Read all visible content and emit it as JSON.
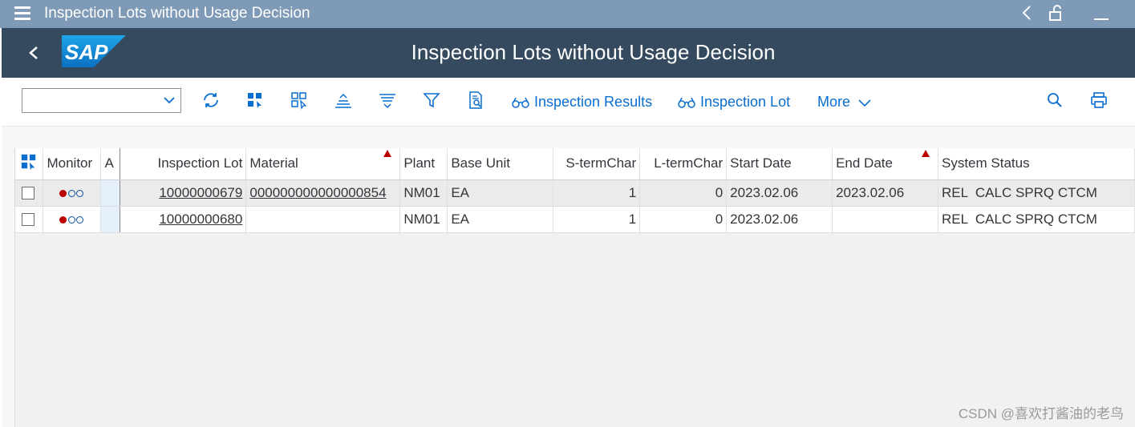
{
  "window": {
    "title": "Inspection Lots without Usage Decision"
  },
  "shell": {
    "app_title": "Inspection Lots without Usage Decision",
    "logo_text": "SAP"
  },
  "toolbar": {
    "variant_select": {
      "value": ""
    },
    "icons": [
      "refresh-icon",
      "select-all-icon",
      "deselect-all-icon",
      "sort-ascending-icon",
      "sort-descending-icon",
      "filter-icon",
      "document-search-icon"
    ],
    "inspection_results_label": "Inspection Results",
    "inspection_lot_label": "Inspection Lot",
    "more_label": "More"
  },
  "table": {
    "columns": [
      "Monitor",
      "A",
      "Inspection Lot",
      "Material",
      "Plant",
      "Base Unit",
      "S-termChar",
      "L-termChar",
      "Start Date",
      "End Date",
      "System Status"
    ],
    "rows": [
      {
        "monitor": "●○○",
        "a": "",
        "inspection_lot": "10000000679",
        "material": "000000000000000854",
        "plant": "NM01",
        "base_unit": "EA",
        "s_term_char": "1",
        "l_term_char": "0",
        "start_date": "2023.02.06",
        "end_date": "2023.02.06",
        "system_status": "REL  CALC SPRQ CTCM"
      },
      {
        "monitor": "●○○",
        "a": "",
        "inspection_lot": "10000000680",
        "material": "",
        "plant": "NM01",
        "base_unit": "EA",
        "s_term_char": "1",
        "l_term_char": "0",
        "start_date": "2023.02.06",
        "end_date": "",
        "system_status": "REL  CALC SPRQ CTCM"
      }
    ]
  },
  "watermark": "CSDN @喜欢打酱油的老鸟",
  "colors": {
    "titlebar": "#7e9ab6",
    "shell": "#354a5f",
    "accent": "#0a6ed1",
    "monitor_red": "#bb0000"
  }
}
